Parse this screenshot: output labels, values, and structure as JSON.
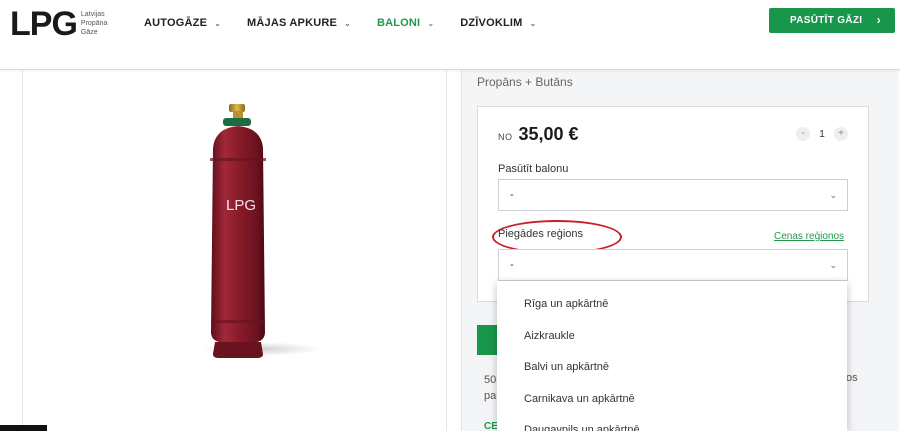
{
  "header": {
    "logo_main": "LPG",
    "logo_sub": [
      "Latvijas",
      "Propāna",
      "Gāze"
    ],
    "nav": [
      {
        "label": "AUTOGĀZE",
        "active": false
      },
      {
        "label": "MĀJAS APKURE",
        "active": false
      },
      {
        "label": "BALONI",
        "active": true
      },
      {
        "label": "DZĪVOKLIM",
        "active": false
      }
    ],
    "order_button": "PASŪTĪT GĀZI",
    "accent_color": "#18974a"
  },
  "product": {
    "cylinder_label": "LPG",
    "cylinder_color": "#8c1c2a"
  },
  "panel": {
    "subtitle": "Propāns + Butāns",
    "price_prefix": "NO",
    "price": "35,00 €",
    "qty_minus": "-",
    "qty_value": "1",
    "qty_plus": "+",
    "order_cylinder_label": "Pasūtīt balonu",
    "order_cylinder_value": "-",
    "region_label": "Piegādes reģions",
    "region_value": "-",
    "prices_link": "Cenas reģionos",
    "info_text_1": "50",
    "info_text_2": "pa",
    "info_tail": "os",
    "green_text": "CE"
  },
  "region_options": [
    "Rīga un apkārtnē",
    "Aizkraukle",
    "Balvi un apkārtnē",
    "Carnikava un apkārtnē",
    "Daugavpils un apkārtnē"
  ]
}
